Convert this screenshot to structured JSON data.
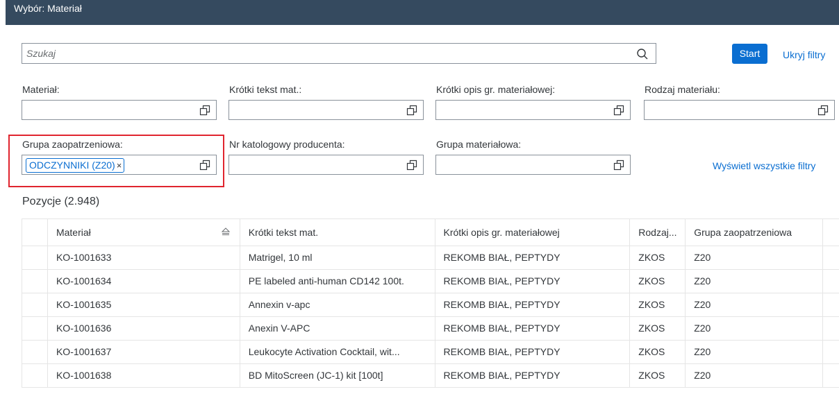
{
  "window": {
    "title": "Wybór: Materiał"
  },
  "search": {
    "placeholder": "Szukaj",
    "value": "",
    "icon": "search-icon"
  },
  "actions": {
    "start": "Start",
    "hide_filters": "Ukryj filtry",
    "show_all_filters": "Wyświetl wszystkie filtry"
  },
  "filters": {
    "material": {
      "label": "Materiał:",
      "value": ""
    },
    "short_text": {
      "label": "Krótki tekst mat.:",
      "value": ""
    },
    "group_desc": {
      "label": "Krótki opis gr. materiałowej:",
      "value": ""
    },
    "material_type": {
      "label": "Rodzaj materiału:",
      "value": ""
    },
    "purchasing_group": {
      "label": "Grupa zaopatrzeniowa:",
      "token": "ODCZYNNIKI (Z20)",
      "token_remove": "×"
    },
    "mfr_part_no": {
      "label": "Nr katologowy producenta:",
      "value": ""
    },
    "material_group": {
      "label": "Grupa materiałowa:",
      "value": ""
    }
  },
  "table": {
    "title": "Pozycje (2.948)",
    "columns": [
      "Materiał",
      "Krótki tekst mat.",
      "Krótki opis gr. materiałowej",
      "Rodzaj...",
      "Grupa zaopatrzeniowa"
    ],
    "rows": [
      [
        "KO-1001633",
        "Matrigel, 10 ml",
        "REKOMB BIAŁ, PEPTYDY",
        "ZKOS",
        "Z20"
      ],
      [
        "KO-1001634",
        "PE labeled anti-human CD142 100t.",
        "REKOMB BIAŁ, PEPTYDY",
        "ZKOS",
        "Z20"
      ],
      [
        "KO-1001635",
        "Annexin v-apc",
        "REKOMB BIAŁ, PEPTYDY",
        "ZKOS",
        "Z20"
      ],
      [
        "KO-1001636",
        "Anexin V-APC",
        "REKOMB BIAŁ, PEPTYDY",
        "ZKOS",
        "Z20"
      ],
      [
        "KO-1001637",
        "Leukocyte Activation Cocktail, wit...",
        "REKOMB BIAŁ, PEPTYDY",
        "ZKOS",
        "Z20"
      ],
      [
        "KO-1001638",
        "BD MitoScreen (JC-1) kit [100t]",
        "REKOMB BIAŁ, PEPTYDY",
        "ZKOS",
        "Z20"
      ]
    ]
  },
  "colors": {
    "shell": "#354a5f",
    "accent": "#0a6ed1",
    "highlight": "#e0242e"
  }
}
